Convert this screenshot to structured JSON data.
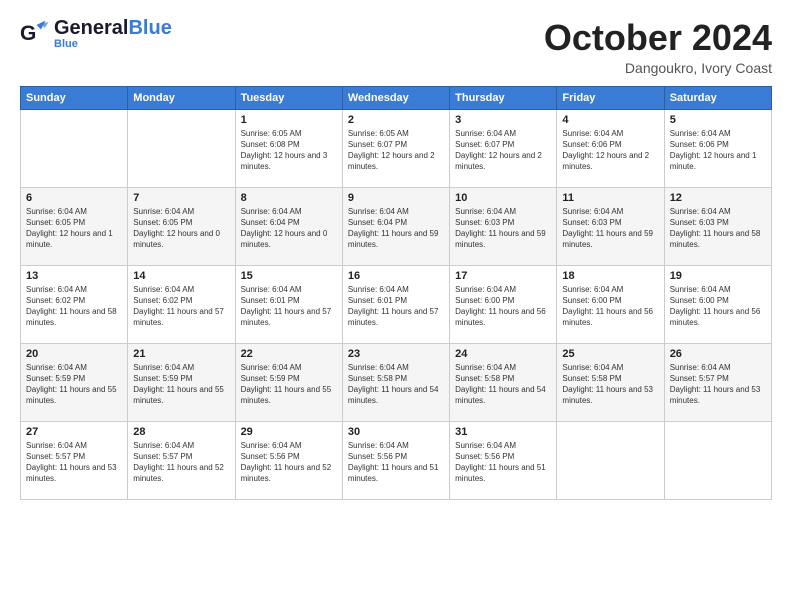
{
  "header": {
    "logo_general": "General",
    "logo_blue": "Blue",
    "month_title": "October 2024",
    "subtitle": "Dangoukro, Ivory Coast"
  },
  "days_of_week": [
    "Sunday",
    "Monday",
    "Tuesday",
    "Wednesday",
    "Thursday",
    "Friday",
    "Saturday"
  ],
  "weeks": [
    [
      {
        "day": "",
        "sunrise": "",
        "sunset": "",
        "daylight": ""
      },
      {
        "day": "",
        "sunrise": "",
        "sunset": "",
        "daylight": ""
      },
      {
        "day": "1",
        "sunrise": "Sunrise: 6:05 AM",
        "sunset": "Sunset: 6:08 PM",
        "daylight": "Daylight: 12 hours and 3 minutes."
      },
      {
        "day": "2",
        "sunrise": "Sunrise: 6:05 AM",
        "sunset": "Sunset: 6:07 PM",
        "daylight": "Daylight: 12 hours and 2 minutes."
      },
      {
        "day": "3",
        "sunrise": "Sunrise: 6:04 AM",
        "sunset": "Sunset: 6:07 PM",
        "daylight": "Daylight: 12 hours and 2 minutes."
      },
      {
        "day": "4",
        "sunrise": "Sunrise: 6:04 AM",
        "sunset": "Sunset: 6:06 PM",
        "daylight": "Daylight: 12 hours and 2 minutes."
      },
      {
        "day": "5",
        "sunrise": "Sunrise: 6:04 AM",
        "sunset": "Sunset: 6:06 PM",
        "daylight": "Daylight: 12 hours and 1 minute."
      }
    ],
    [
      {
        "day": "6",
        "sunrise": "Sunrise: 6:04 AM",
        "sunset": "Sunset: 6:05 PM",
        "daylight": "Daylight: 12 hours and 1 minute."
      },
      {
        "day": "7",
        "sunrise": "Sunrise: 6:04 AM",
        "sunset": "Sunset: 6:05 PM",
        "daylight": "Daylight: 12 hours and 0 minutes."
      },
      {
        "day": "8",
        "sunrise": "Sunrise: 6:04 AM",
        "sunset": "Sunset: 6:04 PM",
        "daylight": "Daylight: 12 hours and 0 minutes."
      },
      {
        "day": "9",
        "sunrise": "Sunrise: 6:04 AM",
        "sunset": "Sunset: 6:04 PM",
        "daylight": "Daylight: 11 hours and 59 minutes."
      },
      {
        "day": "10",
        "sunrise": "Sunrise: 6:04 AM",
        "sunset": "Sunset: 6:03 PM",
        "daylight": "Daylight: 11 hours and 59 minutes."
      },
      {
        "day": "11",
        "sunrise": "Sunrise: 6:04 AM",
        "sunset": "Sunset: 6:03 PM",
        "daylight": "Daylight: 11 hours and 59 minutes."
      },
      {
        "day": "12",
        "sunrise": "Sunrise: 6:04 AM",
        "sunset": "Sunset: 6:03 PM",
        "daylight": "Daylight: 11 hours and 58 minutes."
      }
    ],
    [
      {
        "day": "13",
        "sunrise": "Sunrise: 6:04 AM",
        "sunset": "Sunset: 6:02 PM",
        "daylight": "Daylight: 11 hours and 58 minutes."
      },
      {
        "day": "14",
        "sunrise": "Sunrise: 6:04 AM",
        "sunset": "Sunset: 6:02 PM",
        "daylight": "Daylight: 11 hours and 57 minutes."
      },
      {
        "day": "15",
        "sunrise": "Sunrise: 6:04 AM",
        "sunset": "Sunset: 6:01 PM",
        "daylight": "Daylight: 11 hours and 57 minutes."
      },
      {
        "day": "16",
        "sunrise": "Sunrise: 6:04 AM",
        "sunset": "Sunset: 6:01 PM",
        "daylight": "Daylight: 11 hours and 57 minutes."
      },
      {
        "day": "17",
        "sunrise": "Sunrise: 6:04 AM",
        "sunset": "Sunset: 6:00 PM",
        "daylight": "Daylight: 11 hours and 56 minutes."
      },
      {
        "day": "18",
        "sunrise": "Sunrise: 6:04 AM",
        "sunset": "Sunset: 6:00 PM",
        "daylight": "Daylight: 11 hours and 56 minutes."
      },
      {
        "day": "19",
        "sunrise": "Sunrise: 6:04 AM",
        "sunset": "Sunset: 6:00 PM",
        "daylight": "Daylight: 11 hours and 56 minutes."
      }
    ],
    [
      {
        "day": "20",
        "sunrise": "Sunrise: 6:04 AM",
        "sunset": "Sunset: 5:59 PM",
        "daylight": "Daylight: 11 hours and 55 minutes."
      },
      {
        "day": "21",
        "sunrise": "Sunrise: 6:04 AM",
        "sunset": "Sunset: 5:59 PM",
        "daylight": "Daylight: 11 hours and 55 minutes."
      },
      {
        "day": "22",
        "sunrise": "Sunrise: 6:04 AM",
        "sunset": "Sunset: 5:59 PM",
        "daylight": "Daylight: 11 hours and 55 minutes."
      },
      {
        "day": "23",
        "sunrise": "Sunrise: 6:04 AM",
        "sunset": "Sunset: 5:58 PM",
        "daylight": "Daylight: 11 hours and 54 minutes."
      },
      {
        "day": "24",
        "sunrise": "Sunrise: 6:04 AM",
        "sunset": "Sunset: 5:58 PM",
        "daylight": "Daylight: 11 hours and 54 minutes."
      },
      {
        "day": "25",
        "sunrise": "Sunrise: 6:04 AM",
        "sunset": "Sunset: 5:58 PM",
        "daylight": "Daylight: 11 hours and 53 minutes."
      },
      {
        "day": "26",
        "sunrise": "Sunrise: 6:04 AM",
        "sunset": "Sunset: 5:57 PM",
        "daylight": "Daylight: 11 hours and 53 minutes."
      }
    ],
    [
      {
        "day": "27",
        "sunrise": "Sunrise: 6:04 AM",
        "sunset": "Sunset: 5:57 PM",
        "daylight": "Daylight: 11 hours and 53 minutes."
      },
      {
        "day": "28",
        "sunrise": "Sunrise: 6:04 AM",
        "sunset": "Sunset: 5:57 PM",
        "daylight": "Daylight: 11 hours and 52 minutes."
      },
      {
        "day": "29",
        "sunrise": "Sunrise: 6:04 AM",
        "sunset": "Sunset: 5:56 PM",
        "daylight": "Daylight: 11 hours and 52 minutes."
      },
      {
        "day": "30",
        "sunrise": "Sunrise: 6:04 AM",
        "sunset": "Sunset: 5:56 PM",
        "daylight": "Daylight: 11 hours and 51 minutes."
      },
      {
        "day": "31",
        "sunrise": "Sunrise: 6:04 AM",
        "sunset": "Sunset: 5:56 PM",
        "daylight": "Daylight: 11 hours and 51 minutes."
      },
      {
        "day": "",
        "sunrise": "",
        "sunset": "",
        "daylight": ""
      },
      {
        "day": "",
        "sunrise": "",
        "sunset": "",
        "daylight": ""
      }
    ]
  ]
}
